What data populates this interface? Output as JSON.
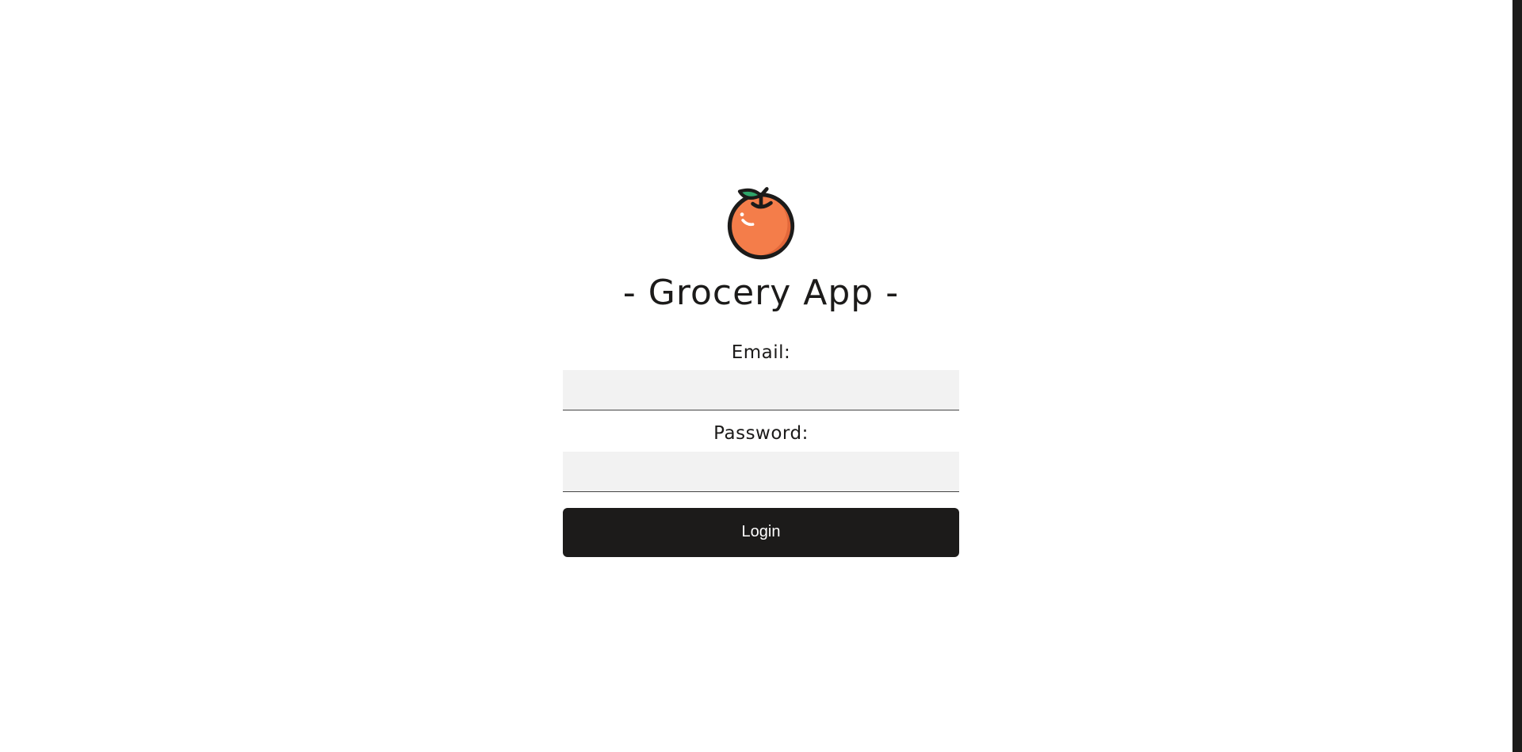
{
  "app": {
    "title": "- Grocery App -",
    "logo_icon": "orange-fruit-icon"
  },
  "form": {
    "email_label": "Email:",
    "email_value": "",
    "password_label": "Password:",
    "password_value": "",
    "login_label": "Login"
  },
  "colors": {
    "background": "#ffffff",
    "text": "#1c1b1a",
    "button": "#1c1b1a",
    "button_text": "#ffffff",
    "input_background": "#f2f2f2",
    "logo_fruit": "#f47d4a",
    "logo_leaf": "#2ea56a"
  }
}
